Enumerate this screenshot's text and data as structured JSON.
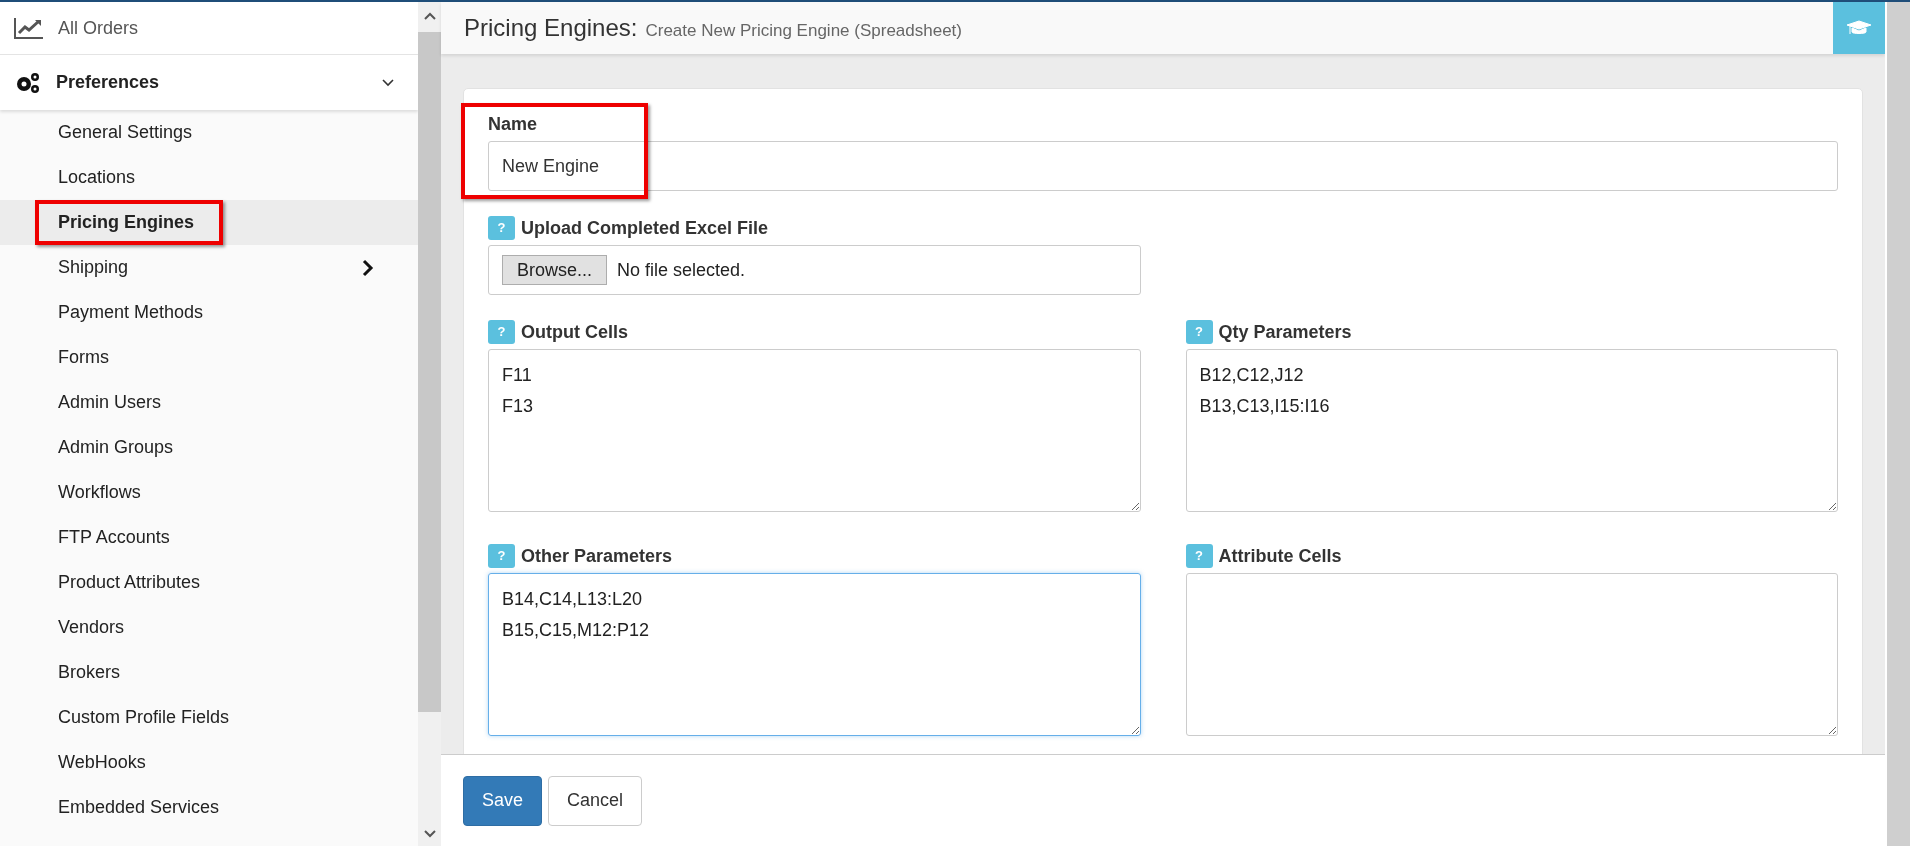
{
  "sidebar": {
    "top_item": {
      "label": "All Orders"
    },
    "section": {
      "label": "Preferences",
      "expanded": true
    },
    "items": [
      {
        "label": "General Settings",
        "selected": false,
        "has_submenu": false,
        "highlighted": false
      },
      {
        "label": "Locations",
        "selected": false,
        "has_submenu": false,
        "highlighted": false
      },
      {
        "label": "Pricing Engines",
        "selected": true,
        "has_submenu": false,
        "highlighted": true
      },
      {
        "label": "Shipping",
        "selected": false,
        "has_submenu": true,
        "highlighted": false
      },
      {
        "label": "Payment Methods",
        "selected": false,
        "has_submenu": false,
        "highlighted": false
      },
      {
        "label": "Forms",
        "selected": false,
        "has_submenu": false,
        "highlighted": false
      },
      {
        "label": "Admin Users",
        "selected": false,
        "has_submenu": false,
        "highlighted": false
      },
      {
        "label": "Admin Groups",
        "selected": false,
        "has_submenu": false,
        "highlighted": false
      },
      {
        "label": "Workflows",
        "selected": false,
        "has_submenu": false,
        "highlighted": false
      },
      {
        "label": "FTP Accounts",
        "selected": false,
        "has_submenu": false,
        "highlighted": false
      },
      {
        "label": "Product Attributes",
        "selected": false,
        "has_submenu": false,
        "highlighted": false
      },
      {
        "label": "Vendors",
        "selected": false,
        "has_submenu": false,
        "highlighted": false
      },
      {
        "label": "Brokers",
        "selected": false,
        "has_submenu": false,
        "highlighted": false
      },
      {
        "label": "Custom Profile Fields",
        "selected": false,
        "has_submenu": false,
        "highlighted": false
      },
      {
        "label": "WebHooks",
        "selected": false,
        "has_submenu": false,
        "highlighted": false
      },
      {
        "label": "Embedded Services",
        "selected": false,
        "has_submenu": false,
        "highlighted": false
      }
    ]
  },
  "header": {
    "title": "Pricing Engines:",
    "subtitle": "Create New Pricing Engine (Spreadsheet)"
  },
  "form": {
    "name": {
      "label": "Name",
      "value": "New Engine",
      "highlighted": true
    },
    "upload": {
      "label": "Upload Completed Excel File",
      "help": "?",
      "button": "Browse...",
      "status": "No file selected."
    },
    "textareas": [
      {
        "label": "Output Cells",
        "help": "?",
        "lines": [
          "F11",
          "F13"
        ],
        "focused": false
      },
      {
        "label": "Qty Parameters",
        "help": "?",
        "lines": [
          "B12,C12,J12",
          "B13,C13,I15:I16"
        ],
        "focused": false
      },
      {
        "label": "Other Parameters",
        "help": "?",
        "lines": [
          "B14,C14,L13:L20",
          "B15,C15,M12:P12"
        ],
        "focused": true
      },
      {
        "label": "Attribute Cells",
        "help": "?",
        "focused": false
      }
    ]
  },
  "buttons": [
    {
      "label": "Save",
      "kind": "primary"
    },
    {
      "label": "Cancel",
      "kind": "default"
    }
  ]
}
